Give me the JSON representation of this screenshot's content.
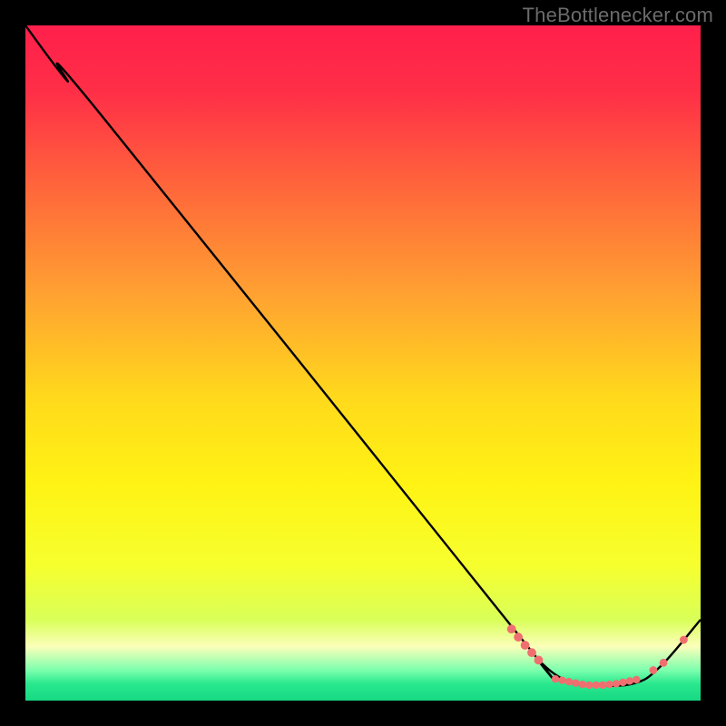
{
  "watermark": "TheBottlenecker.com",
  "chart_data": {
    "type": "line",
    "title": "",
    "xlabel": "",
    "ylabel": "",
    "xlim": [
      0,
      100
    ],
    "ylim": [
      0,
      100
    ],
    "gradient_stops": [
      {
        "offset": 0.0,
        "color": "#ff1f4b"
      },
      {
        "offset": 0.1,
        "color": "#ff2f47"
      },
      {
        "offset": 0.25,
        "color": "#ff6a3a"
      },
      {
        "offset": 0.4,
        "color": "#ffa231"
      },
      {
        "offset": 0.55,
        "color": "#ffd91c"
      },
      {
        "offset": 0.68,
        "color": "#fff314"
      },
      {
        "offset": 0.8,
        "color": "#f6ff2e"
      },
      {
        "offset": 0.88,
        "color": "#d9ff58"
      },
      {
        "offset": 0.92,
        "color": "#fbffba"
      },
      {
        "offset": 0.955,
        "color": "#7cffad"
      },
      {
        "offset": 0.975,
        "color": "#29e88e"
      },
      {
        "offset": 1.0,
        "color": "#17d983"
      }
    ],
    "series": [
      {
        "name": "curve",
        "points": [
          {
            "x": 0.0,
            "y": 100.0
          },
          {
            "x": 6.0,
            "y": 92.0
          },
          {
            "x": 11.0,
            "y": 87.0
          },
          {
            "x": 72.0,
            "y": 11.0
          },
          {
            "x": 76.0,
            "y": 6.0
          },
          {
            "x": 80.0,
            "y": 3.0
          },
          {
            "x": 84.0,
            "y": 2.3
          },
          {
            "x": 90.0,
            "y": 2.5
          },
          {
            "x": 94.0,
            "y": 5.0
          },
          {
            "x": 100.0,
            "y": 12.0
          }
        ]
      }
    ],
    "markers": [
      {
        "x": 72.0,
        "y": 10.6,
        "r": 4.4
      },
      {
        "x": 73.0,
        "y": 9.4,
        "r": 4.4
      },
      {
        "x": 74.0,
        "y": 8.2,
        "r": 4.4
      },
      {
        "x": 75.0,
        "y": 7.1,
        "r": 4.4
      },
      {
        "x": 76.0,
        "y": 6.0,
        "r": 4.4
      },
      {
        "x": 78.5,
        "y": 3.2,
        "r": 3.7
      },
      {
        "x": 79.5,
        "y": 3.0,
        "r": 3.7
      },
      {
        "x": 80.5,
        "y": 2.8,
        "r": 3.7
      },
      {
        "x": 81.5,
        "y": 2.6,
        "r": 3.7
      },
      {
        "x": 82.5,
        "y": 2.4,
        "r": 3.7
      },
      {
        "x": 83.5,
        "y": 2.3,
        "r": 3.7
      },
      {
        "x": 84.5,
        "y": 2.3,
        "r": 3.7
      },
      {
        "x": 85.5,
        "y": 2.3,
        "r": 3.7
      },
      {
        "x": 86.5,
        "y": 2.4,
        "r": 3.7
      },
      {
        "x": 87.5,
        "y": 2.5,
        "r": 3.7
      },
      {
        "x": 88.5,
        "y": 2.7,
        "r": 3.7
      },
      {
        "x": 89.5,
        "y": 2.9,
        "r": 3.7
      },
      {
        "x": 90.5,
        "y": 3.1,
        "r": 3.7
      },
      {
        "x": 93.0,
        "y": 4.5,
        "r": 3.9
      },
      {
        "x": 94.5,
        "y": 5.6,
        "r": 3.9
      },
      {
        "x": 97.5,
        "y": 9.0,
        "r": 3.9
      }
    ],
    "colors": {
      "curve": "#000000",
      "marker_fill": "#ef6f70",
      "marker_stroke": "#ef6f70"
    }
  }
}
